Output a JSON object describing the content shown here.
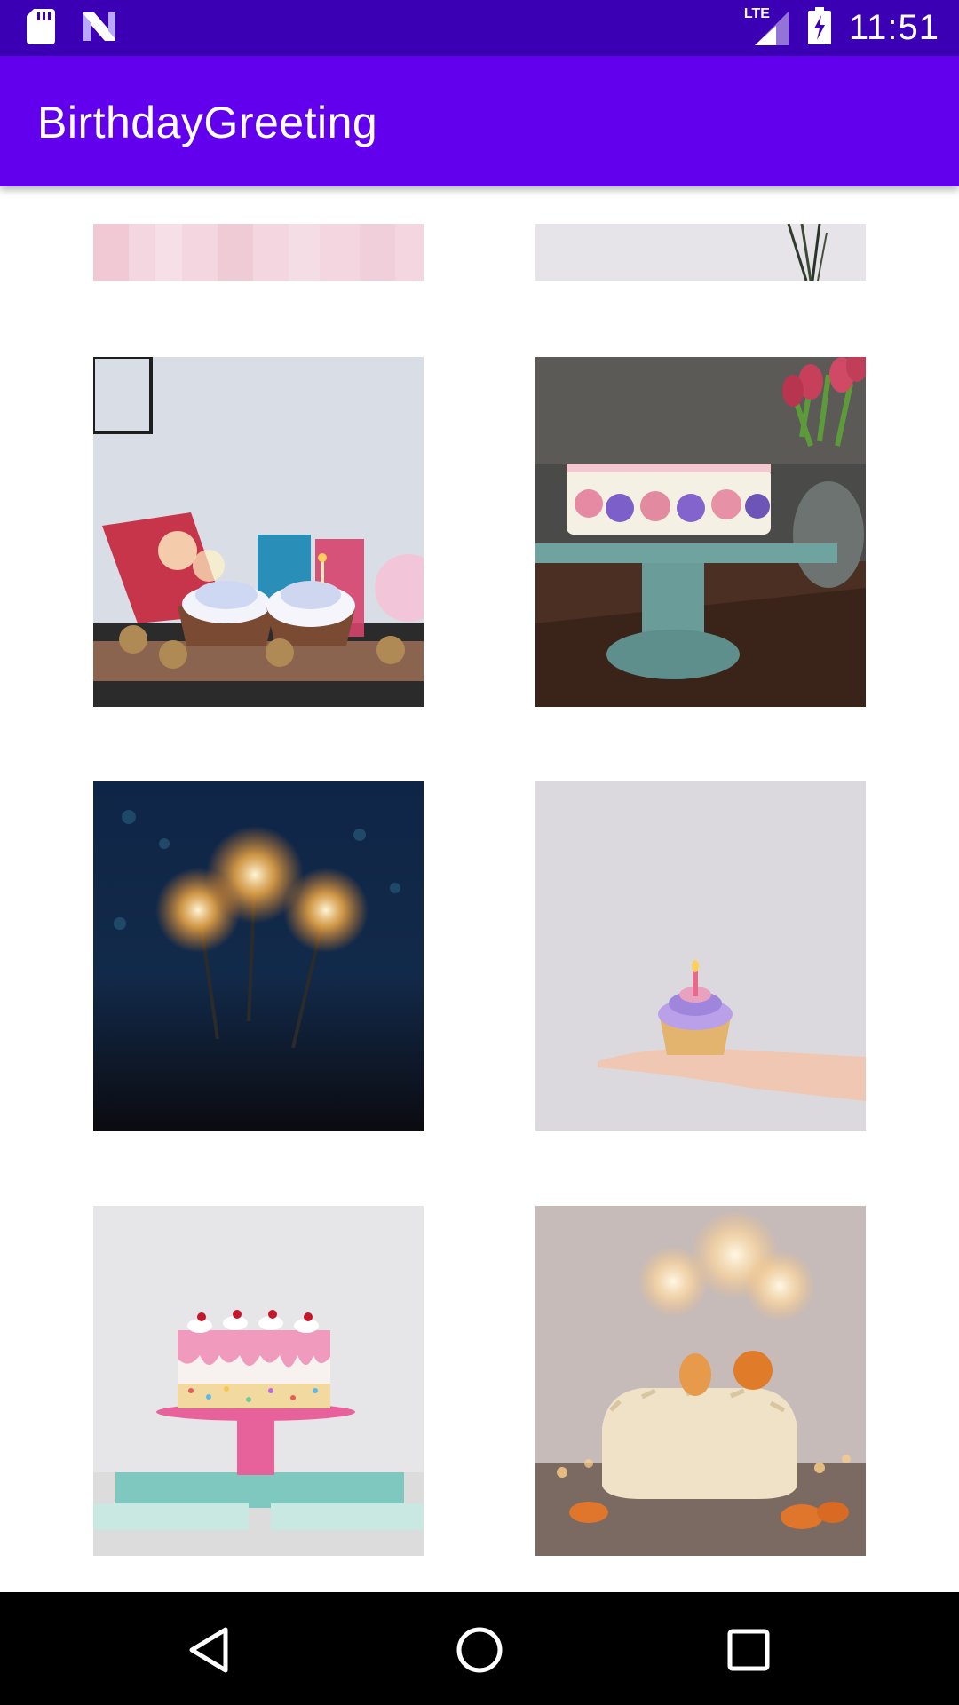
{
  "status_bar": {
    "time": "11:51",
    "network": "LTE",
    "icons": [
      "sd-card-icon",
      "notification-n-icon",
      "lte-signal-icon",
      "battery-charging-icon"
    ],
    "background": "#3b00b3"
  },
  "app_bar": {
    "title": "BirthdayGreeting",
    "background": "#6200ee"
  },
  "gallery": {
    "images": [
      {
        "subject": "pink textured backdrop"
      },
      {
        "subject": "grey wall with plant stems"
      },
      {
        "subject": "cupcakes with sparklers"
      },
      {
        "subject": "floral cake on teal stand with tulips"
      },
      {
        "subject": "sparklers on dark bokeh background"
      },
      {
        "subject": "hand holding cupcake with candle"
      },
      {
        "subject": "pink drip cake on pink stand"
      },
      {
        "subject": "cream cake with sparklers and mandarins"
      }
    ]
  },
  "nav_bar": {
    "buttons": [
      "back-icon",
      "home-icon",
      "recents-icon"
    ],
    "background": "#000000"
  }
}
